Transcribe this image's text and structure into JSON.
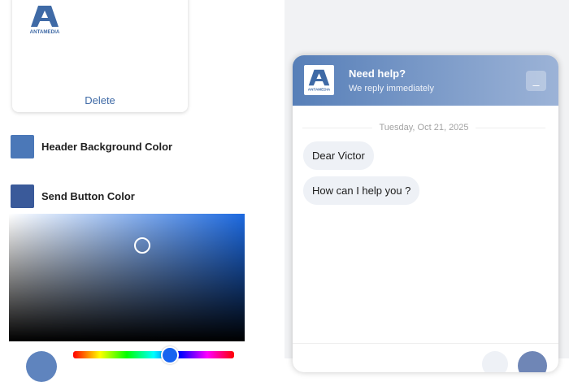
{
  "logo_card": {
    "brand_text": "ANTAMEDIA",
    "delete_label": "Delete"
  },
  "settings": {
    "header_bg": {
      "label": "Header Background Color",
      "color": "#4b78b8"
    },
    "send_button": {
      "label": "Send Button Color",
      "color": "#3a5a9a"
    }
  },
  "picker": {
    "hue_color": "#1c69e0",
    "preview_color": "#5f84be",
    "hue_position": 0.6
  },
  "chat": {
    "title": "Need help?",
    "subtitle": "We reply immediately",
    "minimize_label": "_",
    "date": "Tuesday, Oct 21, 2025",
    "messages": [
      {
        "text": "Dear Victor"
      },
      {
        "text": "How can I help you ?"
      }
    ],
    "send_color": "#6f86b6"
  },
  "colors": {
    "brand": "#3f6aa6",
    "bubble_bg": "#eef1f6"
  }
}
